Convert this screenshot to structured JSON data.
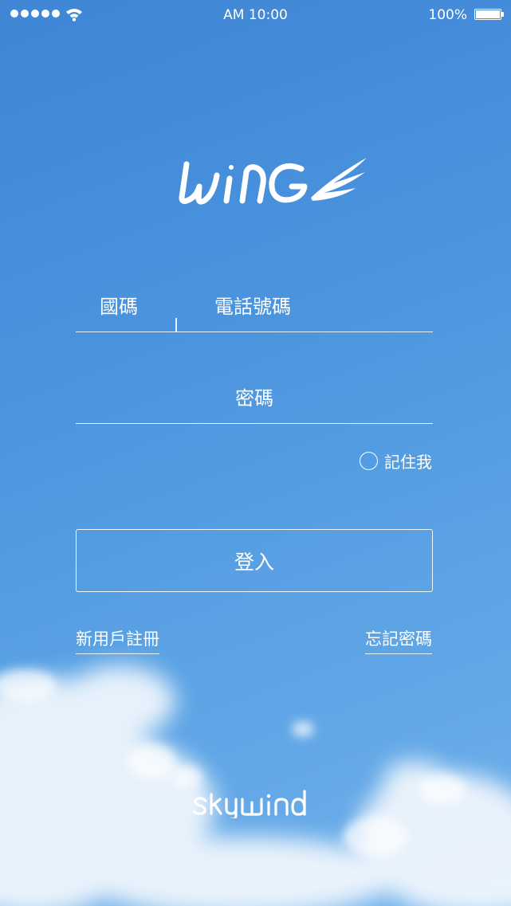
{
  "status_bar": {
    "time": "AM 10:00",
    "battery": "100%",
    "signal_icon": "signal-dots-icon",
    "wifi_icon": "wifi-icon",
    "battery_icon": "battery-icon"
  },
  "logo": {
    "text": "WiNG",
    "icon": "wing-logo-icon"
  },
  "form": {
    "country_code": "國碼",
    "phone_placeholder": "電話號碼",
    "password_placeholder": "密碼",
    "remember_label": "記住我",
    "login_label": "登入"
  },
  "links": {
    "register": "新用戶註冊",
    "forgot_password": "忘記密碼"
  },
  "footer": {
    "brand": "SKYWiND"
  },
  "colors": {
    "sky_top": "#3f86d6",
    "sky_bottom": "#6fb0ea",
    "foreground": "#ffffff"
  }
}
